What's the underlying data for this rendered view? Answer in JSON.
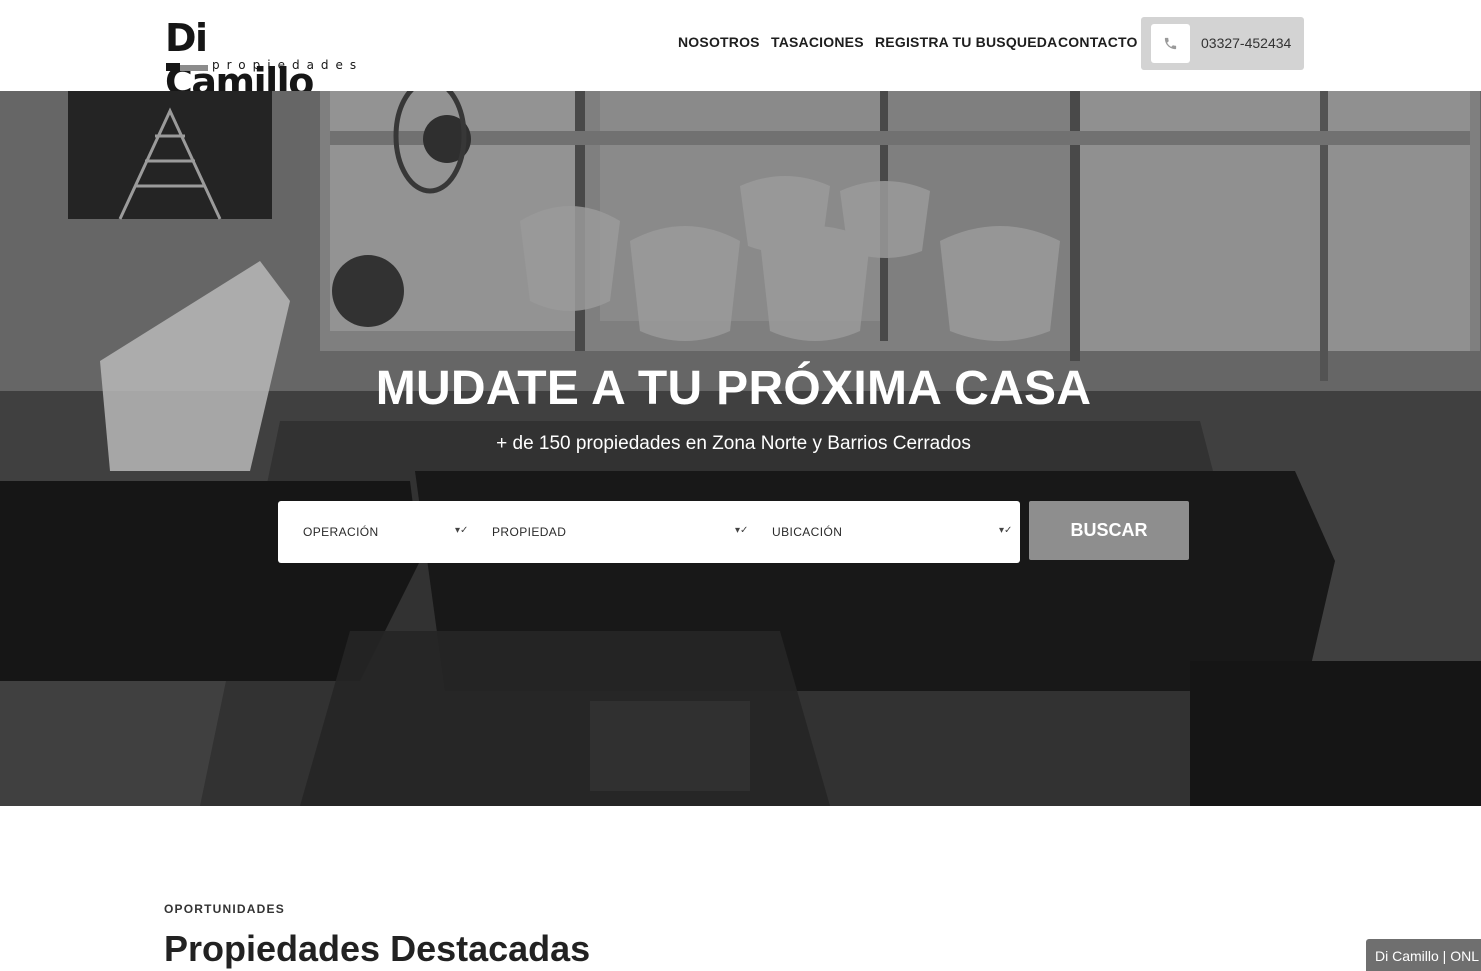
{
  "brand": {
    "name": "Di Camillo",
    "tagline": "propiedades"
  },
  "nav": {
    "items": [
      {
        "label": "NOSOTROS"
      },
      {
        "label": "TASACIONES"
      },
      {
        "label": "REGISTRA TU BUSQUEDA"
      },
      {
        "label": "CONTACTO"
      }
    ],
    "phone": {
      "icon": "phone-icon",
      "number": "03327-452434"
    }
  },
  "hero": {
    "title": "MUDATE A TU PRÓXIMA CASA",
    "subtitle": "+ de 150 propiedades en Zona Norte y Barrios Cerrados",
    "search": {
      "operation": {
        "selected": "OPERACIÓN"
      },
      "property": {
        "selected": "PROPIEDAD"
      },
      "location": {
        "selected": "UBICACIÓN"
      },
      "submit_label": "BUSCAR",
      "dropdown_glyph": "▾✓"
    }
  },
  "featured": {
    "eyebrow": "OPORTUNIDADES",
    "title": "Propiedades Destacadas"
  },
  "chat_widget": {
    "label": "Di Camillo | ONL"
  },
  "colors": {
    "accent_button": "#8e8e8e",
    "phone_button_bg": "#d3d3d3",
    "text_dark": "#222222"
  }
}
